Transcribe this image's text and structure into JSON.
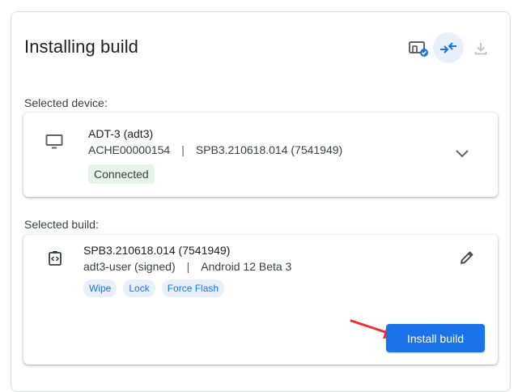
{
  "header": {
    "title": "Installing build",
    "icons": [
      "device-check-icon",
      "connect-arrows-icon",
      "download-icon"
    ]
  },
  "device_section": {
    "label": "Selected device:",
    "device": {
      "name": "ADT-3 (adt3)",
      "serial": "ACHE00000154",
      "separator": "|",
      "build": "SPB3.210618.014 (7541949)",
      "status": "Connected"
    }
  },
  "build_section": {
    "label": "Selected build:",
    "build": {
      "id": "SPB3.210618.014 (7541949)",
      "target": "adt3-user (signed)",
      "separator": "|",
      "release": "Android 12 Beta 3",
      "options": [
        "Wipe",
        "Lock",
        "Force Flash"
      ]
    },
    "install_label": "Install build"
  },
  "colors": {
    "accent": "#1a73e8",
    "connected_bg": "#e6f4ea",
    "annotation_arrow": "#e8312f"
  }
}
